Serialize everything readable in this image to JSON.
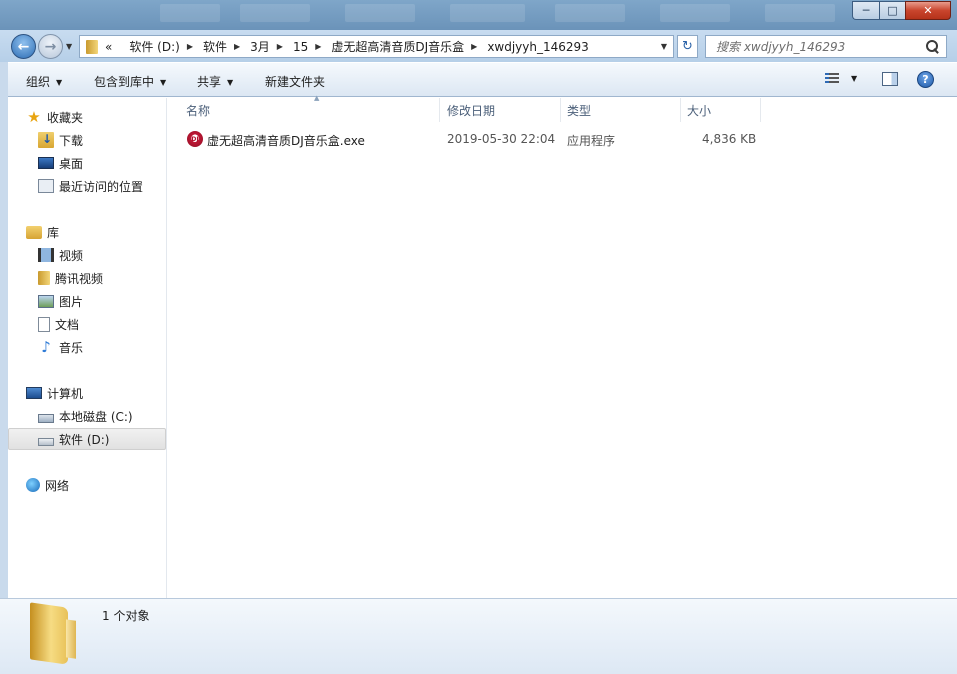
{
  "titlebar": {
    "window_buttons": {
      "minimize": "─",
      "maximize": "□",
      "close": "✕"
    }
  },
  "address": {
    "back_glyph": "←",
    "forward_glyph": "→",
    "overflow": "«",
    "crumbs": [
      "软件 (D:)",
      "软件",
      "3月",
      "15",
      "虚无超高清音质DJ音乐盒",
      "xwdjyyh_146293"
    ],
    "refresh_glyph": "↻",
    "search_placeholder": "搜索 xwdjyyh_146293"
  },
  "commandbar": {
    "organize": "组织",
    "include_in_library": "包含到库中",
    "share": "共享",
    "new_folder": "新建文件夹",
    "help": "?"
  },
  "navpane": {
    "favorites": {
      "label": "收藏夹",
      "items": [
        "下载",
        "桌面",
        "最近访问的位置"
      ]
    },
    "libraries": {
      "label": "库",
      "items": [
        "视频",
        "腾讯视频",
        "图片",
        "文档",
        "音乐"
      ]
    },
    "computer": {
      "label": "计算机",
      "items": [
        "本地磁盘 (C:)",
        "软件 (D:)"
      ],
      "selected": "软件 (D:)"
    },
    "network": {
      "label": "网络"
    }
  },
  "filelist": {
    "columns": {
      "name": "名称",
      "modified": "修改日期",
      "type": "类型",
      "size": "大小"
    },
    "files": [
      {
        "name": "虚无超高清音质DJ音乐盒.exe",
        "modified": "2019-05-30 22:04",
        "type": "应用程序",
        "size": "4,836 KB",
        "icon": "dj-app-icon"
      }
    ]
  },
  "details": {
    "count_text": "1 个对象"
  },
  "colors": {
    "titlebar": "#7fa6c9",
    "close_button": "#c9452d",
    "header_text": "#4c607a",
    "selection": "#e1e1e1"
  }
}
